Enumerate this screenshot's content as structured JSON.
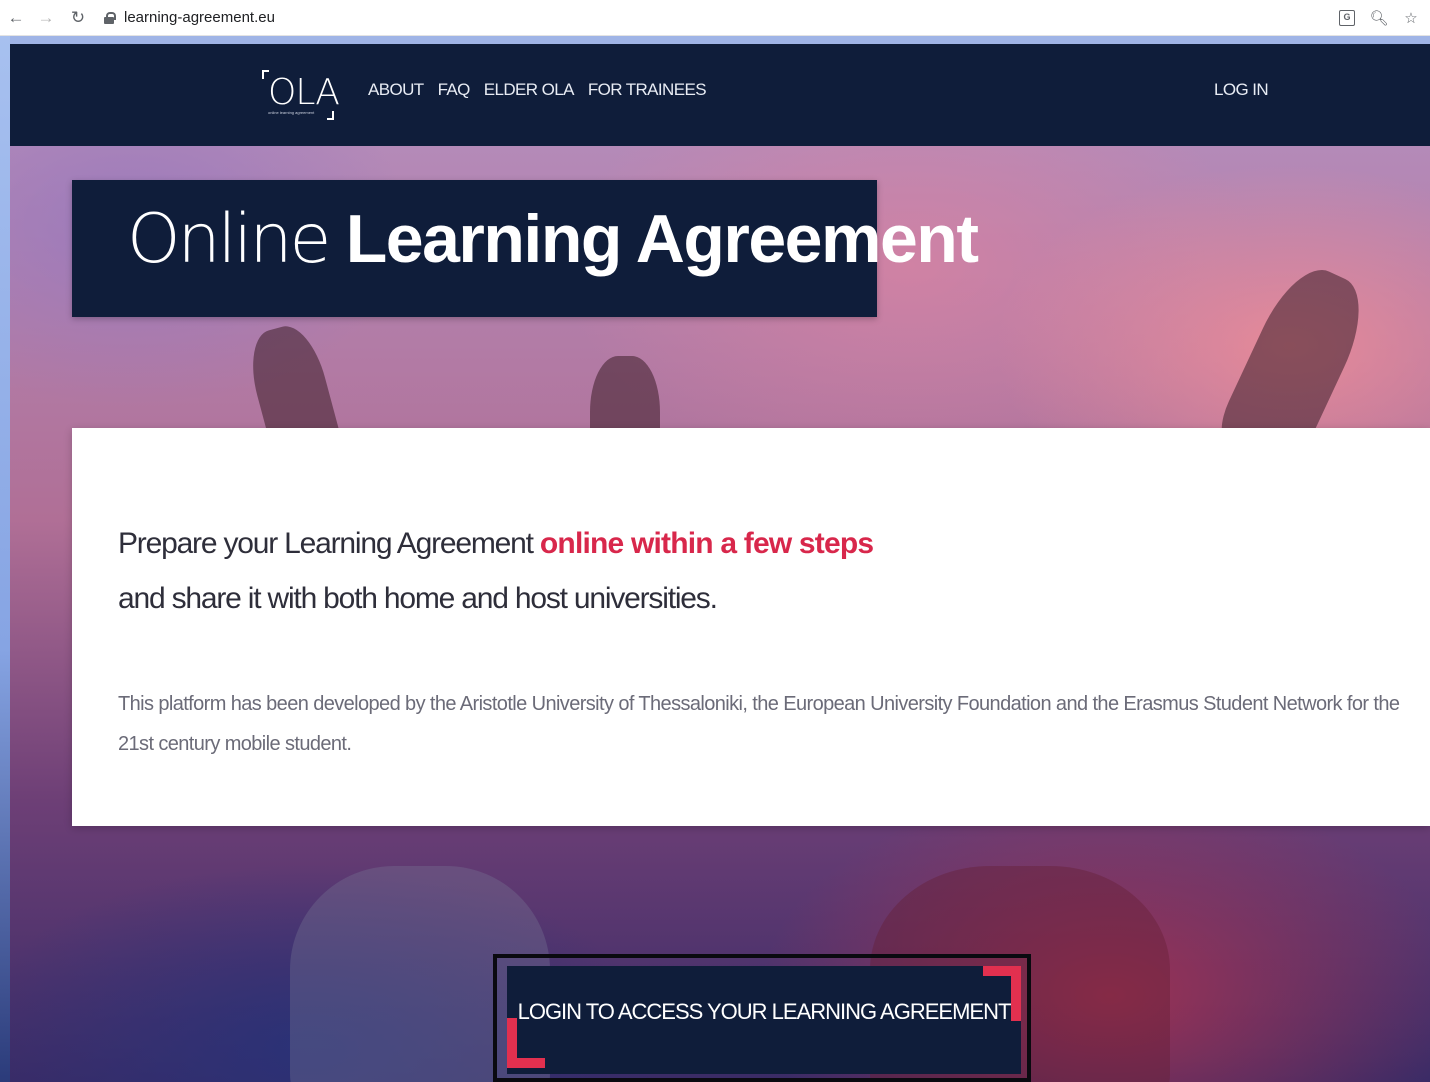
{
  "browser": {
    "url": "learning-agreement.eu",
    "icons": [
      "back-icon",
      "forward-icon",
      "reload-icon",
      "lock-icon",
      "translate-icon",
      "zoom-icon",
      "star-icon"
    ]
  },
  "header": {
    "logo_text": "OLA",
    "logo_tagline": "online learning agreement",
    "menu": [
      {
        "label": "ABOUT"
      },
      {
        "label": "FAQ"
      },
      {
        "label": "ELDER OLA"
      },
      {
        "label": "FOR TRAINEES"
      }
    ],
    "login_label": "LOG IN"
  },
  "hero": {
    "title_light": "Online",
    "title_bold": "Learning Agreement"
  },
  "intro": {
    "lead_start": "Prepare your Learning Agreement",
    "lead_highlight": "online within a few steps",
    "lead_end": "and share it with both home and host universities.",
    "description": "This platform has been developed by the Aristotle University of Thessaloniki, the European University Foundation and the Erasmus Student Network for the 21st century mobile student."
  },
  "cta": {
    "label": "LOGIN TO ACCESS YOUR LEARNING AGREEMENT"
  },
  "colors": {
    "navy": "#0f1d3a",
    "accent": "#d8274b"
  }
}
